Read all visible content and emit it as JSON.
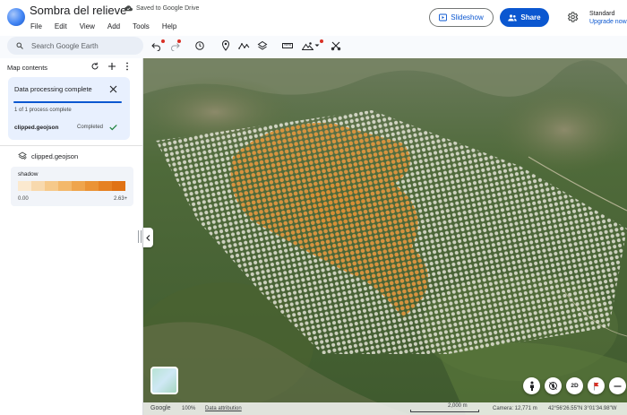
{
  "app": {
    "title": "Sombra del relieve",
    "save_status": "Saved to Google Drive",
    "menu": [
      "File",
      "Edit",
      "View",
      "Add",
      "Tools",
      "Help"
    ],
    "slideshow_label": "Slideshow",
    "share_label": "Share",
    "plan_name": "Standard",
    "upgrade_label": "Upgrade now",
    "brand_color": "#0b57d0"
  },
  "toolbar": {
    "search_placeholder": "Search Google Earth",
    "tools": [
      "undo-icon",
      "redo-icon",
      "history-icon",
      "pin-icon",
      "path-icon",
      "layers-icon",
      "ruler-icon",
      "terrain-icon",
      "tools-icon"
    ]
  },
  "sidebar": {
    "title": "Map contents",
    "status": {
      "title": "Data processing complete",
      "progress_fraction": 1.0,
      "progress_text": "1 of 1 process complete",
      "file_name": "clipped.geojson",
      "file_status": "Completed"
    },
    "layer": {
      "name": "clipped.geojson",
      "legend_title": "shadow",
      "legend_min": "0.00",
      "legend_max": "2.63+",
      "legend_colors": [
        "#fbe9cf",
        "#f8d9ad",
        "#f6c98a",
        "#f3b86b",
        "#efa54d",
        "#eb9335",
        "#e68122",
        "#e07214"
      ]
    }
  },
  "map": {
    "footer": {
      "brand": "Google",
      "zoom": "100%",
      "attribution": "Data attribution",
      "scale": "2,000 m",
      "camera": "Camera: 12,771 m",
      "coords": "42°56'26.55\"N 3°01'34.98\"W"
    },
    "buttons": {
      "view_2d": "2D"
    }
  }
}
